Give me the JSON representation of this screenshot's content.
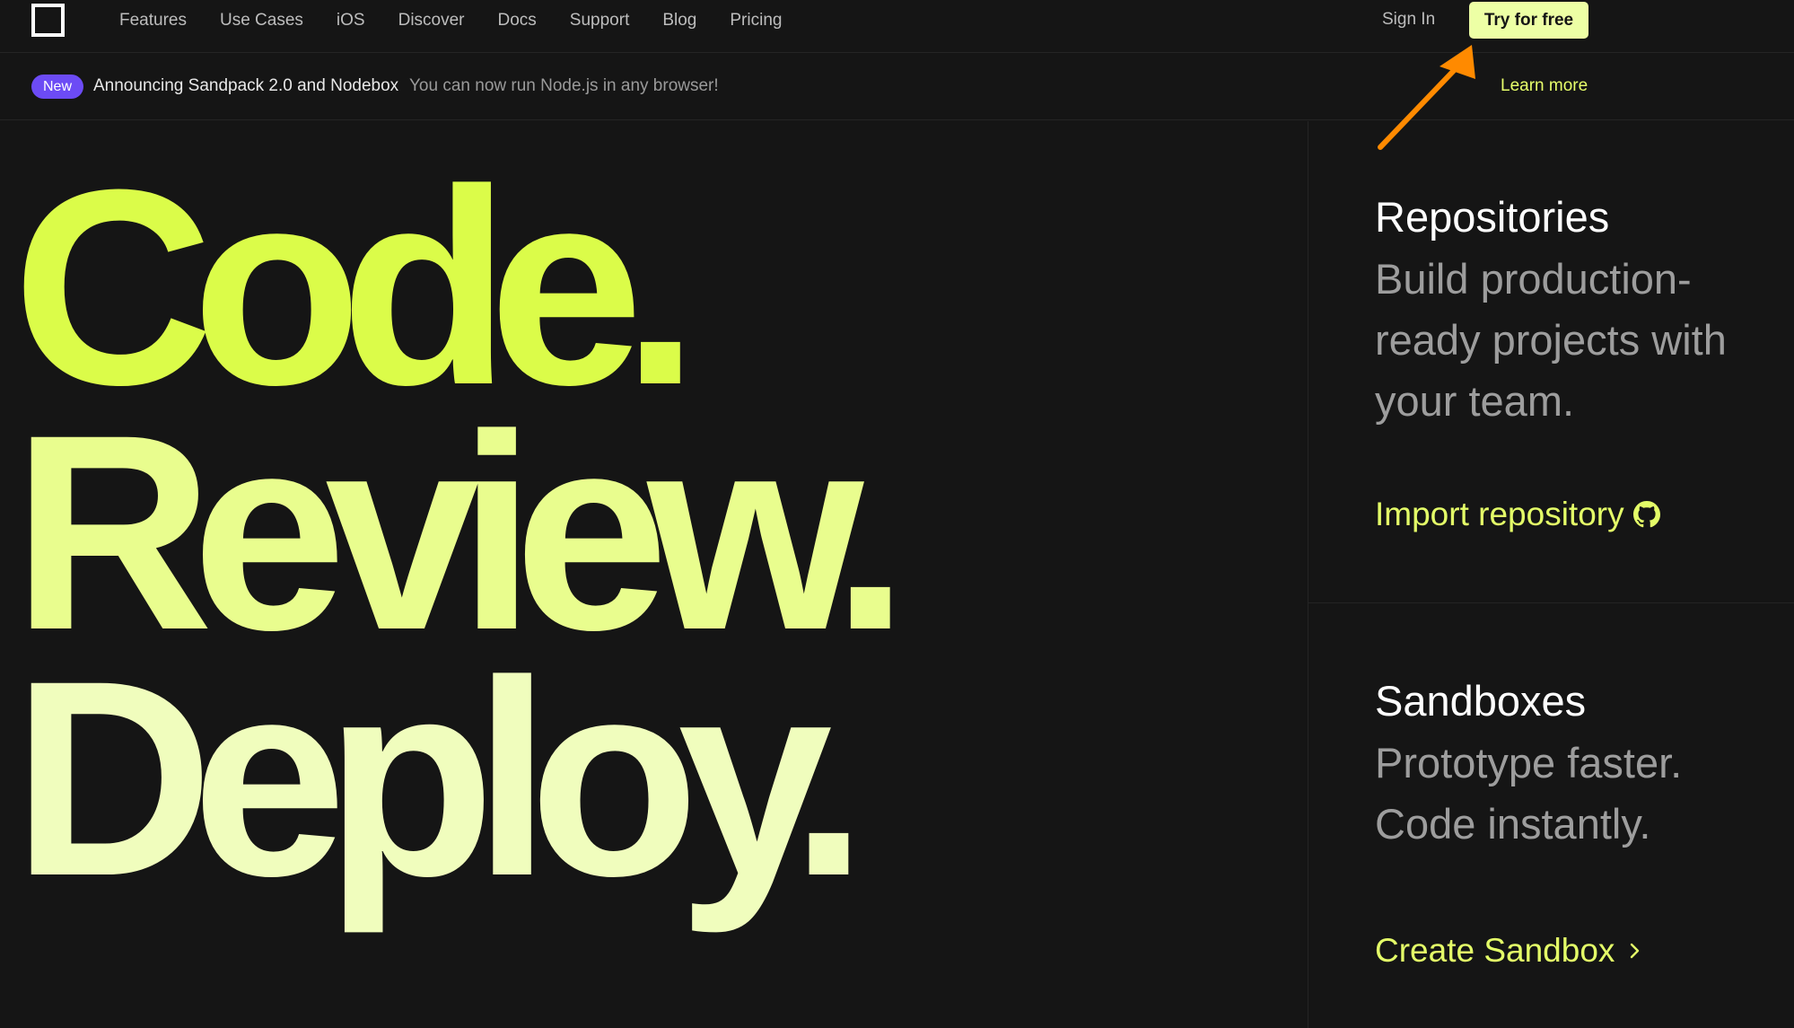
{
  "nav": {
    "links": [
      "Features",
      "Use Cases",
      "iOS",
      "Discover",
      "Docs",
      "Support",
      "Blog",
      "Pricing"
    ],
    "sign_in": "Sign In",
    "cta": "Try for free"
  },
  "announcement": {
    "badge": "New",
    "title": "Announcing Sandpack 2.0 and Nodebox",
    "subtitle": "You can now run Node.js in any browser!",
    "link": "Learn more"
  },
  "hero": {
    "line1": "Code.",
    "line2": "Review.",
    "line3": "Deploy."
  },
  "repositories": {
    "title": "Repositories",
    "description": "Build production-ready projects with your team.",
    "link": "Import repository",
    "link_icon": "github-icon"
  },
  "sandboxes": {
    "title": "Sandboxes",
    "description": "Prototype faster. Code instantly.",
    "link": "Create Sandbox",
    "link_icon": "chevron-right-icon"
  },
  "colors": {
    "background": "#151515",
    "accent": "#dbfc49",
    "cta_bg": "#edffa5",
    "badge": "#6c4bf5",
    "annotation_arrow": "#ff8a00"
  }
}
